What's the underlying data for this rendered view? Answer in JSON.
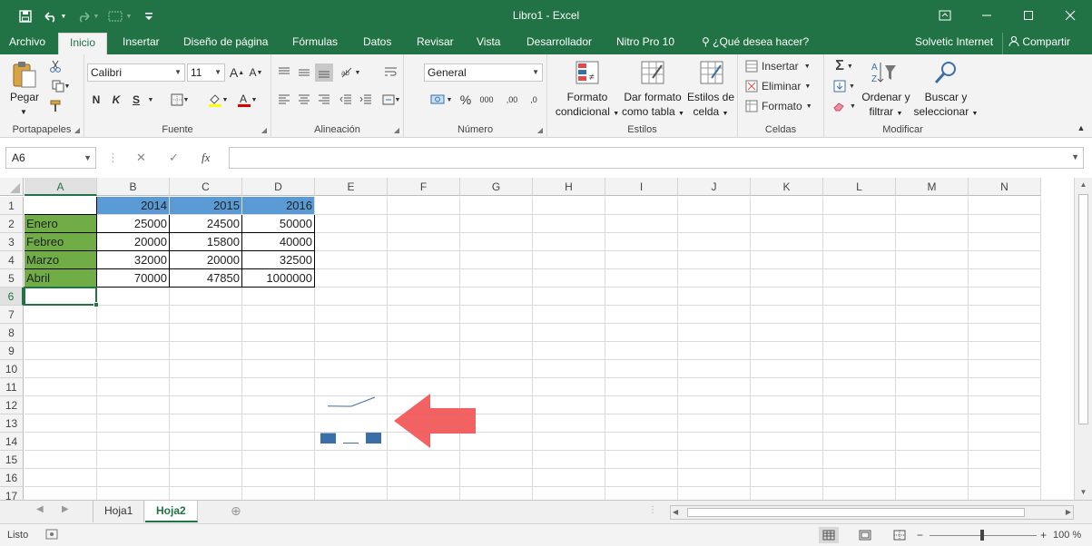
{
  "window": {
    "title": "Libro1 - Excel",
    "controls": [
      "restore-ribbon",
      "minimize",
      "maximize",
      "close"
    ]
  },
  "quick_access": {
    "icons": [
      "save-icon",
      "undo-icon",
      "redo-icon",
      "touch-mode-icon",
      "customize-icon"
    ]
  },
  "tabs": [
    {
      "label": "Archivo",
      "active": false
    },
    {
      "label": "Inicio",
      "active": true
    },
    {
      "label": "Insertar",
      "active": false
    },
    {
      "label": "Diseño de página",
      "active": false
    },
    {
      "label": "Fórmulas",
      "active": false
    },
    {
      "label": "Datos",
      "active": false
    },
    {
      "label": "Revisar",
      "active": false
    },
    {
      "label": "Vista",
      "active": false
    },
    {
      "label": "Desarrollador",
      "active": false
    },
    {
      "label": "Nitro Pro 10",
      "active": false
    }
  ],
  "tell_me": "¿Qué desea hacer?",
  "account": "Solvetic Internet",
  "share": "Compartir",
  "ribbon": {
    "clipboard": {
      "group": "Portapapeles",
      "paste": "Pegar"
    },
    "font": {
      "group": "Fuente",
      "font_name": "Calibri",
      "font_size": "11",
      "bold": "N",
      "italic": "K",
      "underline": "S"
    },
    "alignment": {
      "group": "Alineación"
    },
    "number": {
      "group": "Número",
      "format": "General",
      "percent": "%",
      "thousands": "000",
      "inc_decimal": ",00",
      "dec_decimal": ",0"
    },
    "styles": {
      "group": "Estilos",
      "conditional_1": "Formato",
      "conditional_2": "condicional",
      "table_1": "Dar formato",
      "table_2": "como tabla",
      "cell_1": "Estilos de",
      "cell_2": "celda"
    },
    "cells": {
      "group": "Celdas",
      "insert": "Insertar",
      "delete": "Eliminar",
      "format": "Formato"
    },
    "editing": {
      "group": "Modificar",
      "sort_1": "Ordenar y",
      "sort_2": "filtrar",
      "find_1": "Buscar y",
      "find_2": "seleccionar"
    }
  },
  "formula_bar": {
    "name_box": "A6",
    "fx_label": "fx",
    "formula": ""
  },
  "columns": [
    "A",
    "B",
    "C",
    "D",
    "E",
    "F",
    "G",
    "H",
    "I",
    "J",
    "K",
    "L",
    "M",
    "N"
  ],
  "rows": [
    "1",
    "2",
    "3",
    "4",
    "5",
    "6",
    "7",
    "8",
    "9",
    "10",
    "11",
    "12",
    "13",
    "14",
    "15",
    "16",
    "17"
  ],
  "selected_cell": "A6",
  "table": {
    "header": [
      "",
      "2014",
      "2015",
      "2016"
    ],
    "rows": [
      {
        "label": "Enero",
        "values": [
          "25000",
          "24500",
          "50000"
        ]
      },
      {
        "label": "Febreo",
        "values": [
          "20000",
          "15800",
          "40000"
        ]
      },
      {
        "label": "Marzo",
        "values": [
          "32000",
          "20000",
          "32500"
        ]
      },
      {
        "label": "Abril",
        "values": [
          "70000",
          "47850",
          "1000000"
        ]
      }
    ]
  },
  "sparklines": {
    "line_row2": {
      "type": "line",
      "values": [
        25000,
        24500,
        50000
      ]
    },
    "column_row4": {
      "type": "column",
      "values": [
        32000,
        20000,
        32500
      ]
    }
  },
  "colors": {
    "accent": "#217346",
    "header_fill": "#5b9bd5",
    "label_fill": "#70ad47",
    "sparkline": "#3a6ea8",
    "arrow": "#f25a5a"
  },
  "sheets": [
    {
      "label": "Hoja1",
      "active": false
    },
    {
      "label": "Hoja2",
      "active": true
    }
  ],
  "status": {
    "ready": "Listo",
    "zoom": "100 %"
  }
}
